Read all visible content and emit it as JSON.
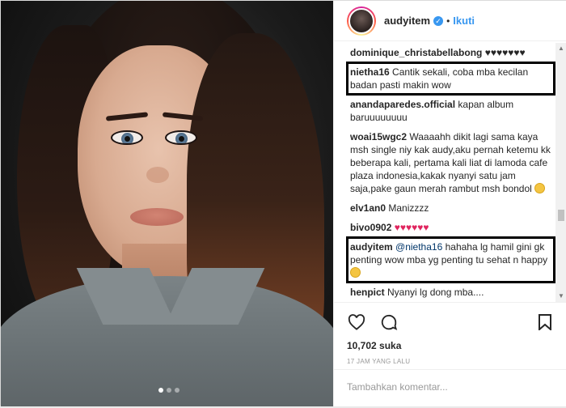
{
  "header": {
    "username": "audyitem",
    "separator": "•",
    "follow_label": "Ikuti"
  },
  "comments": [
    {
      "user": "dominique_christabellabong",
      "text": "♥♥♥♥♥♥♥",
      "highlighted": false
    },
    {
      "user": "nietha16",
      "text": "Cantik sekali, coba mba kecilan badan pasti makin wow",
      "highlighted": true
    },
    {
      "user": "anandaparedes.official",
      "text": "kapan album baruuuuuuuu",
      "highlighted": false
    },
    {
      "user": "woai15wgc2",
      "text": "Waaaahh dikit lagi sama kaya msh single niy kak audy,aku pernah ketemu kk beberapa kali, pertama kali liat di lamoda cafe plaza indonesia,kakak nyanyi satu jam saja,pake gaun merah rambut msh bondol",
      "highlighted": false
    },
    {
      "user": "elv1an0",
      "text": "Manizzzz",
      "highlighted": false
    },
    {
      "user": "bivo0902",
      "text": "♥♥♥♥♥♥",
      "highlighted": false
    },
    {
      "user": "audyitem",
      "mention": "@nietha16",
      "text": "hahaha lg hamil gini gk penting wow mba yg penting tu sehat n happy",
      "highlighted": true
    },
    {
      "user": "henpict",
      "text": "Nyanyi lg dong mba....",
      "highlighted": false
    }
  ],
  "likes_text": "10,702 suka",
  "time_text": "17 JAM YANG LALU",
  "add_comment_placeholder": "Tambahkan komentar...",
  "colors": {
    "accent": "#3897f0",
    "heart_red": "#e0245e",
    "text": "#262626"
  }
}
